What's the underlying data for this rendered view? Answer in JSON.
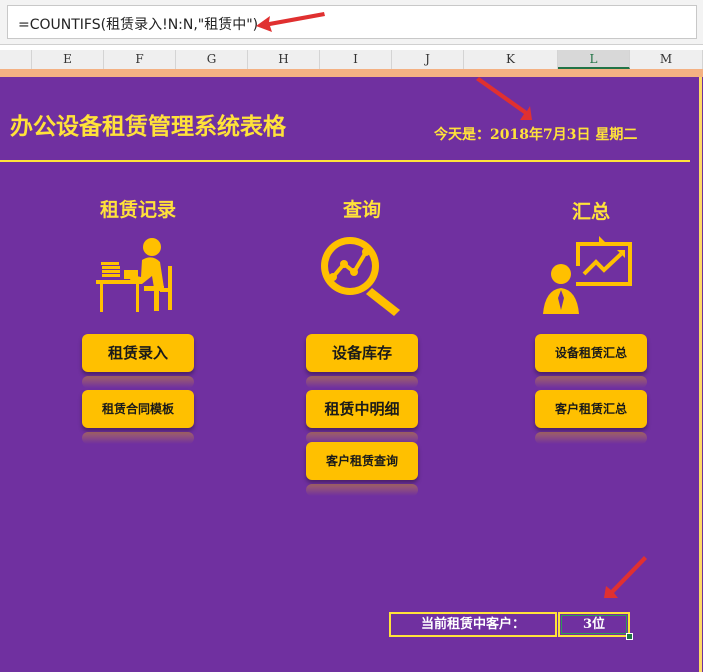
{
  "formula_bar": {
    "formula": "=COUNTIFS(租赁录入!N:N,\"租赁中\")"
  },
  "columns": [
    {
      "label": "E",
      "selected": false
    },
    {
      "label": "F",
      "selected": false
    },
    {
      "label": "G",
      "selected": false
    },
    {
      "label": "H",
      "selected": false
    },
    {
      "label": "I",
      "selected": false
    },
    {
      "label": "J",
      "selected": false
    },
    {
      "label": "K",
      "selected": false
    },
    {
      "label": "L",
      "selected": true
    },
    {
      "label": "M",
      "selected": false
    }
  ],
  "header": {
    "title": "办公设备租赁管理系统表格",
    "date": "今天是：2018年7月3日 星期二"
  },
  "sections": {
    "rental": {
      "title": "租赁记录",
      "icon": "person-at-desk-icon",
      "buttons": [
        "租赁录入",
        "租赁合同模板"
      ]
    },
    "query": {
      "title": "查询",
      "icon": "magnifier-chart-icon",
      "buttons": [
        "设备库存",
        "租赁中明细",
        "客户租赁查询"
      ]
    },
    "summary": {
      "title": "汇总",
      "icon": "presenter-chart-icon",
      "buttons": [
        "设备租赁汇总",
        "客户租赁汇总"
      ]
    }
  },
  "footer": {
    "label": "当前租赁中客户：",
    "value": "3位"
  },
  "colors": {
    "sheet_background": "#7030a0",
    "accent_yellow": "#ffe23a",
    "button": "#ffc000",
    "annotation_arrow": "#e03030"
  }
}
